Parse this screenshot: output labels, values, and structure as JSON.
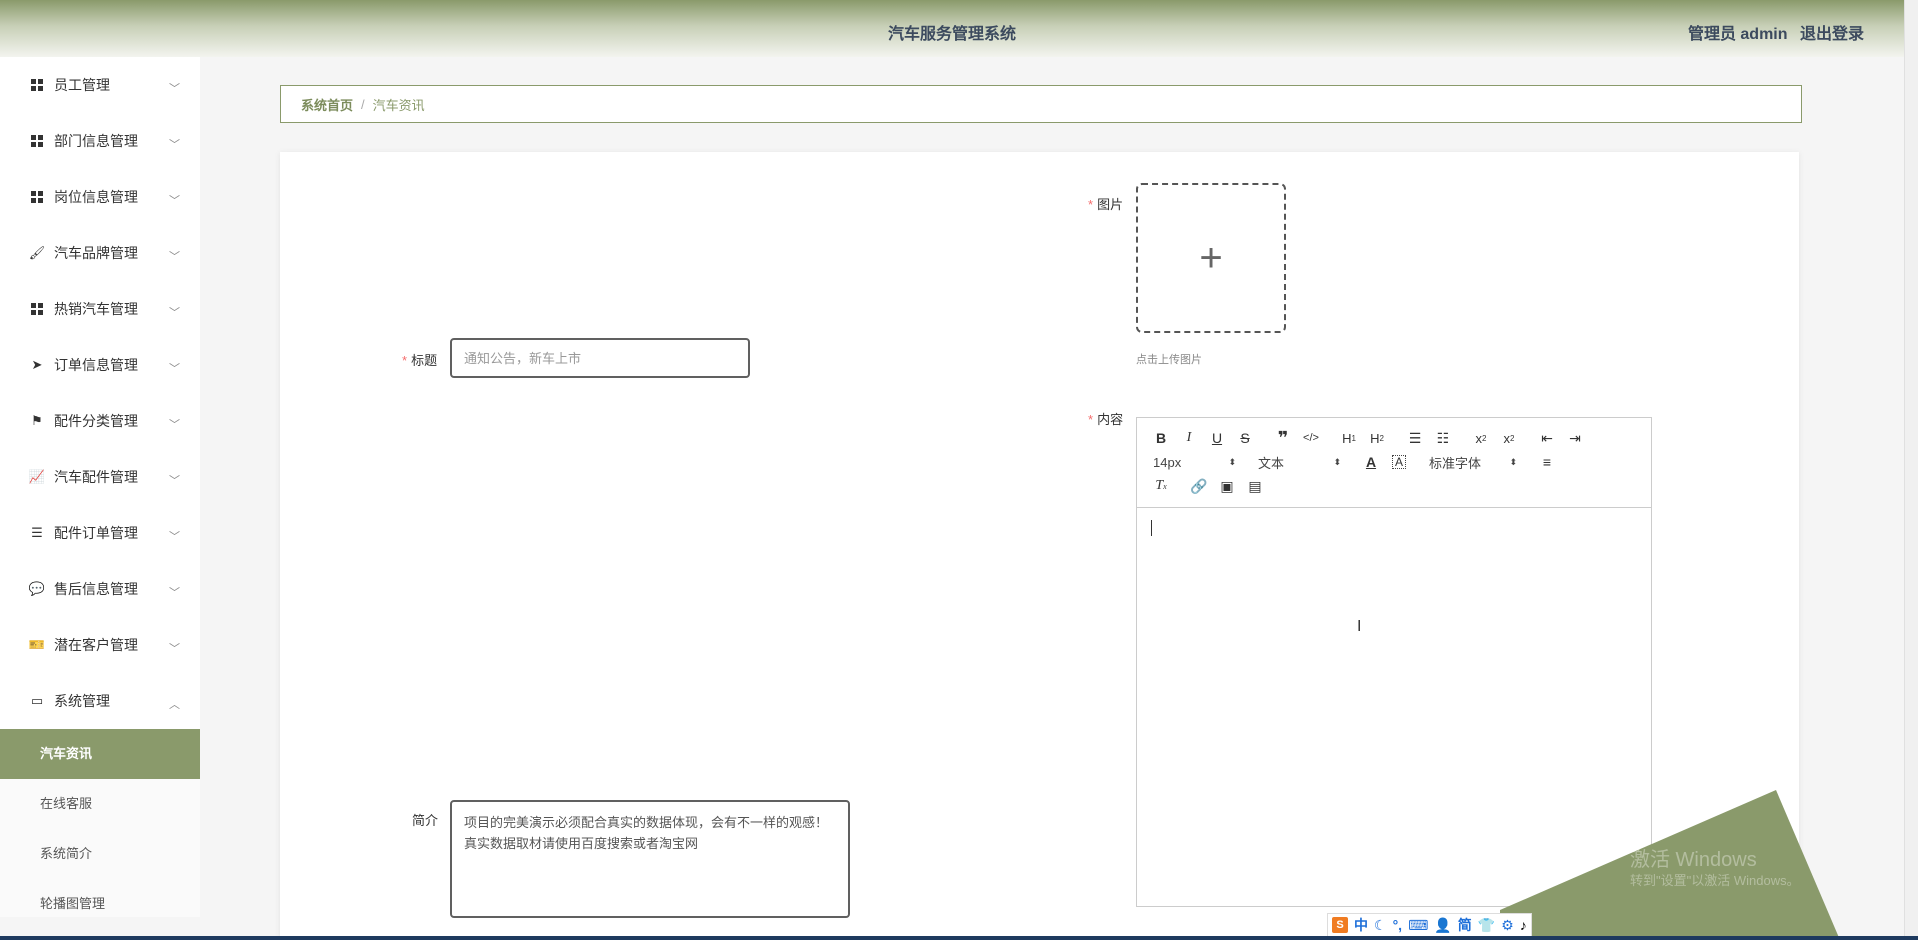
{
  "header": {
    "title": "汽车服务管理系统",
    "user_label": "管理员 admin",
    "logout_label": "退出登录"
  },
  "sidebar": {
    "items": [
      {
        "label": "员工管理",
        "icon": "grid-icon"
      },
      {
        "label": "部门信息管理",
        "icon": "grid-icon"
      },
      {
        "label": "岗位信息管理",
        "icon": "grid-icon"
      },
      {
        "label": "汽车品牌管理",
        "icon": "brush-icon"
      },
      {
        "label": "热销汽车管理",
        "icon": "grid-icon"
      },
      {
        "label": "订单信息管理",
        "icon": "send-icon"
      },
      {
        "label": "配件分类管理",
        "icon": "flag-icon"
      },
      {
        "label": "汽车配件管理",
        "icon": "chart-icon"
      },
      {
        "label": "配件订单管理",
        "icon": "list-icon"
      },
      {
        "label": "售后信息管理",
        "icon": "chat-icon"
      },
      {
        "label": "潜在客户管理",
        "icon": "ticket-icon"
      },
      {
        "label": "系统管理",
        "icon": "monitor-icon",
        "expanded": true
      }
    ],
    "submenu": [
      {
        "label": "汽车资讯",
        "active": true
      },
      {
        "label": "在线客服"
      },
      {
        "label": "系统简介"
      },
      {
        "label": "轮播图管理"
      }
    ]
  },
  "breadcrumb": {
    "home": "系统首页",
    "separator": "/",
    "current": "汽车资讯"
  },
  "form": {
    "title_label": "标题",
    "title_placeholder": "通知公告，新车上市",
    "image_label": "图片",
    "upload_tip": "点击上传图片",
    "content_label": "内容",
    "intro_label": "简介",
    "intro_value": "项目的完美演示必须配合真实的数据体现，会有不一样的观感！真实数据取材请使用百度搜索或者淘宝网"
  },
  "editor": {
    "font_size": "14px",
    "header_select": "文本",
    "font_family": "标准字体"
  },
  "watermark": {
    "line1": "激活 Windows",
    "line2": "转到\"设置\"以激活 Windows。"
  },
  "ime": {
    "lang": "中",
    "mode": "简"
  },
  "colors": {
    "accent": "#8a9a6b",
    "required": "#f56c6c"
  }
}
